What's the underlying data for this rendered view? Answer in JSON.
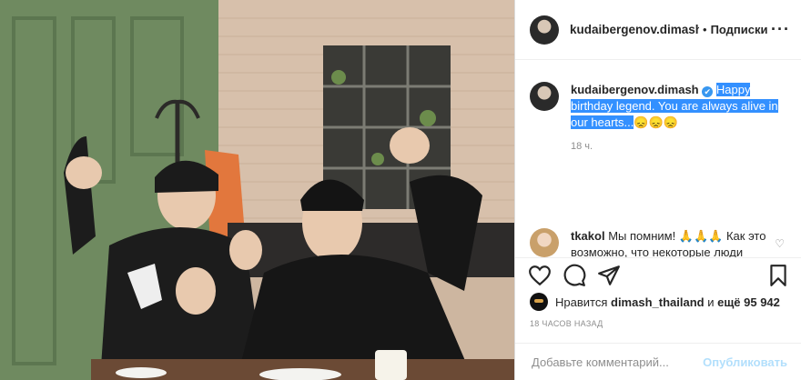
{
  "post": {
    "username": "kudaibergenov.dimash",
    "separator": "•",
    "follow_label": "Подписки",
    "more_label": "···"
  },
  "caption": {
    "username": "kudaibergenov.dimash",
    "verified_icon": "✔",
    "text": "Happy birthday legend. You are always alive in our hearts...",
    "emoji": "😞😞😞",
    "time": "18 ч."
  },
  "comment": {
    "username": "tkakol",
    "text": "Мы помним! 🙏🙏🙏 Как это возможно, что некоторые люди принимают решение о жизни других людей? Это вопрос, на который я ищу ответ..."
  },
  "likes": {
    "prefix": "Нравится",
    "user": "dimash_thailand",
    "conj": "и",
    "more": "ещё 95 942"
  },
  "timestamp": "18 ЧАСОВ НАЗАД",
  "add_comment": {
    "placeholder": "Добавьте комментарий...",
    "post_label": "Опубликовать"
  },
  "colors": {
    "highlight": "#3390ff",
    "verified": "#3897f0",
    "post_disabled": "#b2dffc"
  }
}
